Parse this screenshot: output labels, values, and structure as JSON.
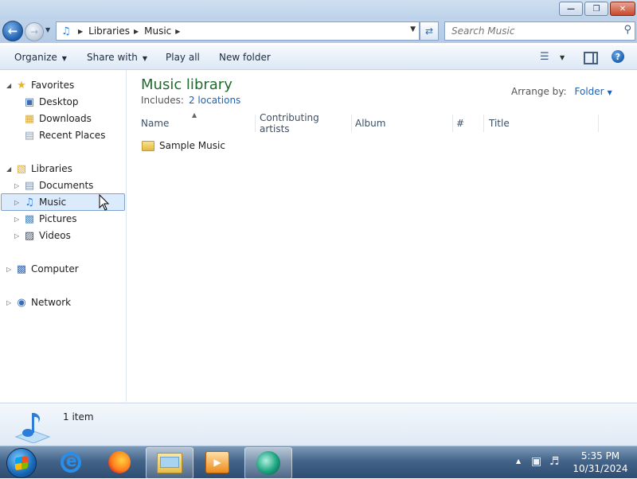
{
  "window": {
    "caption_buttons": [
      "minimize-icon",
      "restore-icon",
      "close-icon"
    ]
  },
  "address": {
    "crumbs": [
      "Libraries",
      "Music"
    ]
  },
  "search": {
    "placeholder": "Search Music"
  },
  "toolbar": {
    "organize": "Organize",
    "share_with": "Share with",
    "play_all": "Play all",
    "new_folder": "New folder"
  },
  "nav": {
    "favorites": "Favorites",
    "desktop": "Desktop",
    "downloads": "Downloads",
    "recent_places": "Recent Places",
    "libraries": "Libraries",
    "documents": "Documents",
    "music": "Music",
    "pictures": "Pictures",
    "videos": "Videos",
    "computer": "Computer",
    "network": "Network"
  },
  "content": {
    "title": "Music library",
    "includes_label": "Includes:",
    "includes_link": "2 locations",
    "arrange_label": "Arrange by:",
    "arrange_value": "Folder",
    "columns": [
      "Name",
      "Contributing artists",
      "Album",
      "#",
      "Title"
    ],
    "items": [
      {
        "name": "Sample Music"
      }
    ]
  },
  "details": {
    "count": "1 item"
  },
  "taskbar": {
    "time": "5:35 PM",
    "date": "10/31/2024"
  },
  "colors": {
    "accent_green": "#1e6b2e",
    "link_blue": "#1d62b8",
    "selection": "#dcebfc"
  }
}
